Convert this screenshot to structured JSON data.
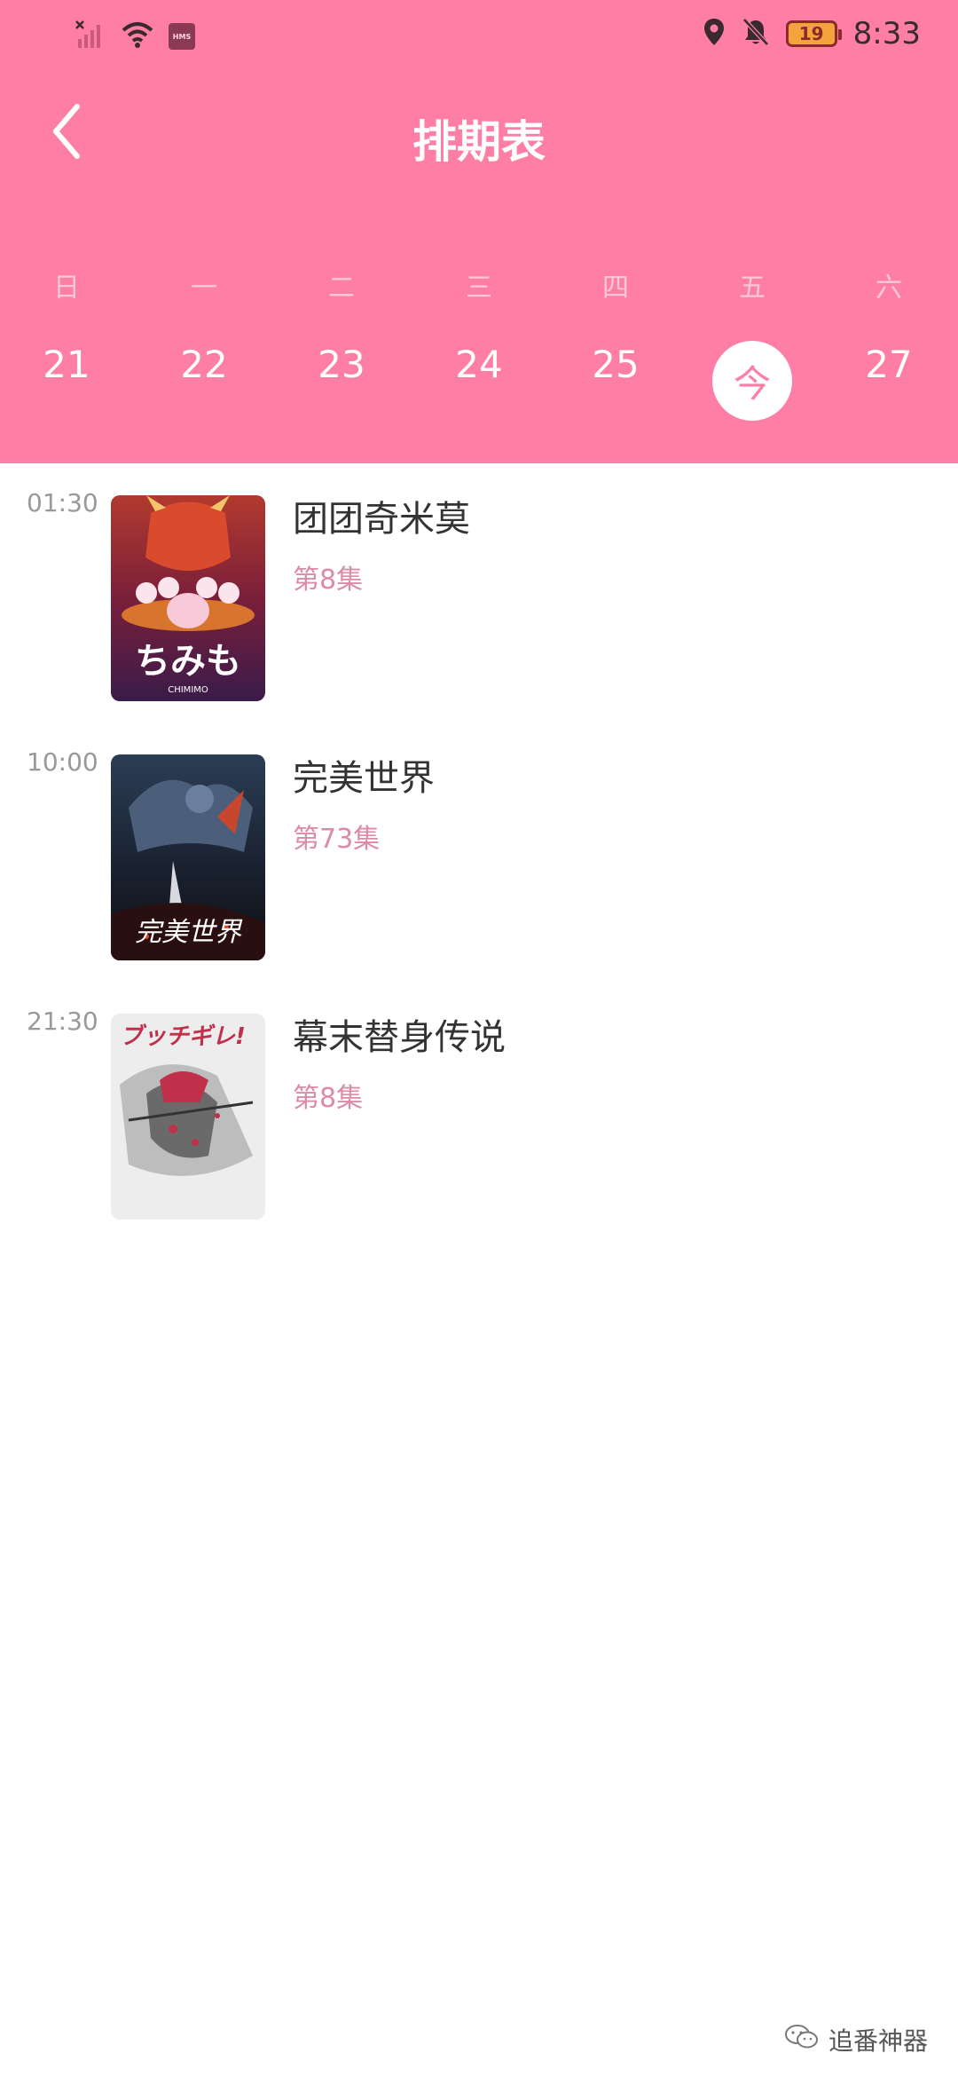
{
  "status_bar": {
    "time": "8:33",
    "battery": "19",
    "hms_badge": "HMS",
    "icons": [
      "no-signal-icon",
      "wifi-icon",
      "hms-icon",
      "location-icon",
      "bell-muted-icon",
      "battery-icon"
    ]
  },
  "header": {
    "title": "排期表",
    "back_icon": "chevron-left-icon",
    "accent_color": "#ff7ea6"
  },
  "week": {
    "days": [
      {
        "label": "日",
        "num": "21"
      },
      {
        "label": "一",
        "num": "22"
      },
      {
        "label": "二",
        "num": "23"
      },
      {
        "label": "三",
        "num": "24"
      },
      {
        "label": "四",
        "num": "25"
      },
      {
        "label": "五",
        "num": "今"
      },
      {
        "label": "六",
        "num": "27"
      }
    ],
    "selected_index": 5
  },
  "schedule": [
    {
      "time": "01:30",
      "title": "团团奇米莫",
      "episode": "第8集"
    },
    {
      "time": "10:00",
      "title": "完美世界",
      "episode": "第73集"
    },
    {
      "time": "21:30",
      "title": "幕末替身传说",
      "episode": "第8集"
    }
  ],
  "posters": [
    {
      "caption": "ちみも",
      "subcaption": "CHIMIMO"
    },
    {
      "caption": "完美世界"
    },
    {
      "caption": "ブッチギレ!"
    }
  ],
  "watermark": {
    "text": "追番神器",
    "icon": "wechat-icon"
  }
}
